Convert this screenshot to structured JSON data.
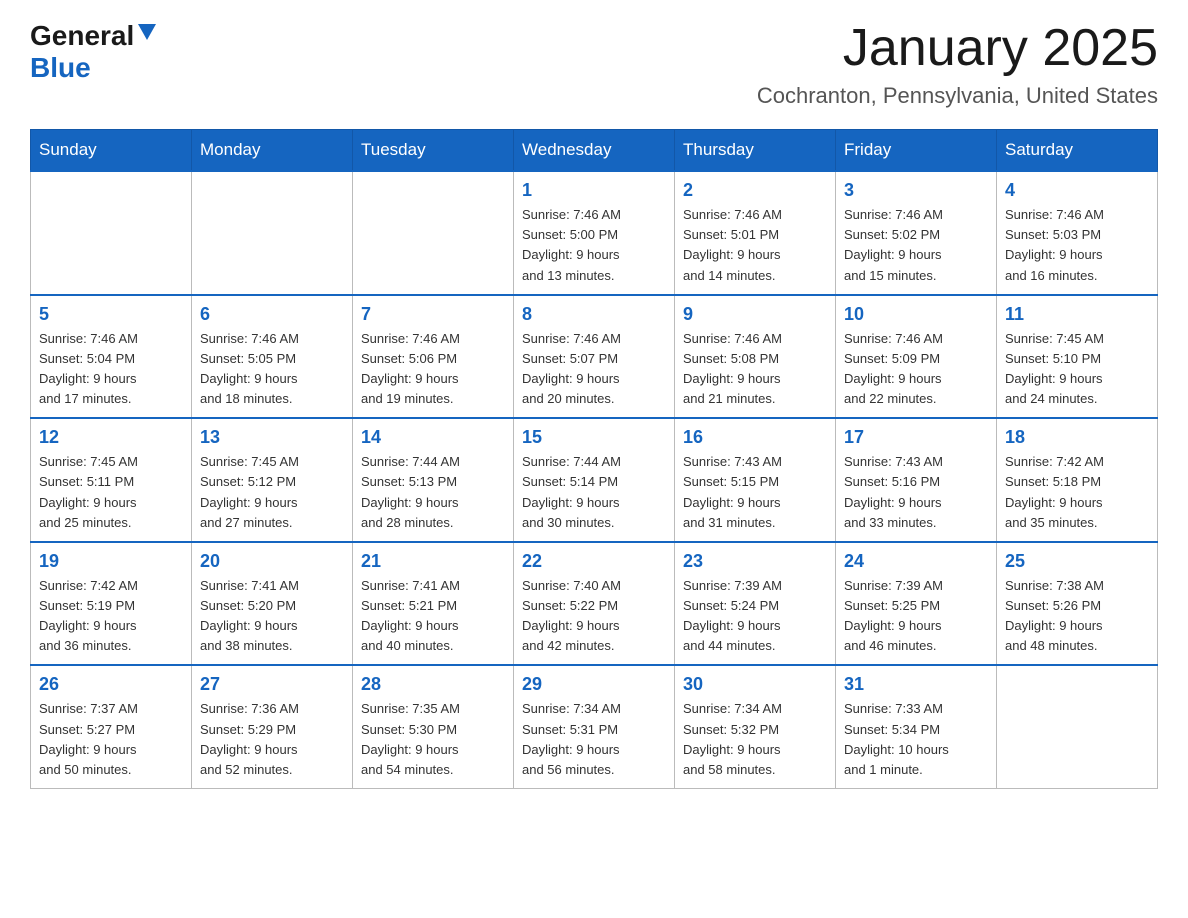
{
  "header": {
    "logo_general": "General",
    "logo_blue": "Blue",
    "title": "January 2025",
    "subtitle": "Cochranton, Pennsylvania, United States"
  },
  "days_of_week": [
    "Sunday",
    "Monday",
    "Tuesday",
    "Wednesday",
    "Thursday",
    "Friday",
    "Saturday"
  ],
  "weeks": [
    [
      {
        "day": "",
        "info": ""
      },
      {
        "day": "",
        "info": ""
      },
      {
        "day": "",
        "info": ""
      },
      {
        "day": "1",
        "info": "Sunrise: 7:46 AM\nSunset: 5:00 PM\nDaylight: 9 hours\nand 13 minutes."
      },
      {
        "day": "2",
        "info": "Sunrise: 7:46 AM\nSunset: 5:01 PM\nDaylight: 9 hours\nand 14 minutes."
      },
      {
        "day": "3",
        "info": "Sunrise: 7:46 AM\nSunset: 5:02 PM\nDaylight: 9 hours\nand 15 minutes."
      },
      {
        "day": "4",
        "info": "Sunrise: 7:46 AM\nSunset: 5:03 PM\nDaylight: 9 hours\nand 16 minutes."
      }
    ],
    [
      {
        "day": "5",
        "info": "Sunrise: 7:46 AM\nSunset: 5:04 PM\nDaylight: 9 hours\nand 17 minutes."
      },
      {
        "day": "6",
        "info": "Sunrise: 7:46 AM\nSunset: 5:05 PM\nDaylight: 9 hours\nand 18 minutes."
      },
      {
        "day": "7",
        "info": "Sunrise: 7:46 AM\nSunset: 5:06 PM\nDaylight: 9 hours\nand 19 minutes."
      },
      {
        "day": "8",
        "info": "Sunrise: 7:46 AM\nSunset: 5:07 PM\nDaylight: 9 hours\nand 20 minutes."
      },
      {
        "day": "9",
        "info": "Sunrise: 7:46 AM\nSunset: 5:08 PM\nDaylight: 9 hours\nand 21 minutes."
      },
      {
        "day": "10",
        "info": "Sunrise: 7:46 AM\nSunset: 5:09 PM\nDaylight: 9 hours\nand 22 minutes."
      },
      {
        "day": "11",
        "info": "Sunrise: 7:45 AM\nSunset: 5:10 PM\nDaylight: 9 hours\nand 24 minutes."
      }
    ],
    [
      {
        "day": "12",
        "info": "Sunrise: 7:45 AM\nSunset: 5:11 PM\nDaylight: 9 hours\nand 25 minutes."
      },
      {
        "day": "13",
        "info": "Sunrise: 7:45 AM\nSunset: 5:12 PM\nDaylight: 9 hours\nand 27 minutes."
      },
      {
        "day": "14",
        "info": "Sunrise: 7:44 AM\nSunset: 5:13 PM\nDaylight: 9 hours\nand 28 minutes."
      },
      {
        "day": "15",
        "info": "Sunrise: 7:44 AM\nSunset: 5:14 PM\nDaylight: 9 hours\nand 30 minutes."
      },
      {
        "day": "16",
        "info": "Sunrise: 7:43 AM\nSunset: 5:15 PM\nDaylight: 9 hours\nand 31 minutes."
      },
      {
        "day": "17",
        "info": "Sunrise: 7:43 AM\nSunset: 5:16 PM\nDaylight: 9 hours\nand 33 minutes."
      },
      {
        "day": "18",
        "info": "Sunrise: 7:42 AM\nSunset: 5:18 PM\nDaylight: 9 hours\nand 35 minutes."
      }
    ],
    [
      {
        "day": "19",
        "info": "Sunrise: 7:42 AM\nSunset: 5:19 PM\nDaylight: 9 hours\nand 36 minutes."
      },
      {
        "day": "20",
        "info": "Sunrise: 7:41 AM\nSunset: 5:20 PM\nDaylight: 9 hours\nand 38 minutes."
      },
      {
        "day": "21",
        "info": "Sunrise: 7:41 AM\nSunset: 5:21 PM\nDaylight: 9 hours\nand 40 minutes."
      },
      {
        "day": "22",
        "info": "Sunrise: 7:40 AM\nSunset: 5:22 PM\nDaylight: 9 hours\nand 42 minutes."
      },
      {
        "day": "23",
        "info": "Sunrise: 7:39 AM\nSunset: 5:24 PM\nDaylight: 9 hours\nand 44 minutes."
      },
      {
        "day": "24",
        "info": "Sunrise: 7:39 AM\nSunset: 5:25 PM\nDaylight: 9 hours\nand 46 minutes."
      },
      {
        "day": "25",
        "info": "Sunrise: 7:38 AM\nSunset: 5:26 PM\nDaylight: 9 hours\nand 48 minutes."
      }
    ],
    [
      {
        "day": "26",
        "info": "Sunrise: 7:37 AM\nSunset: 5:27 PM\nDaylight: 9 hours\nand 50 minutes."
      },
      {
        "day": "27",
        "info": "Sunrise: 7:36 AM\nSunset: 5:29 PM\nDaylight: 9 hours\nand 52 minutes."
      },
      {
        "day": "28",
        "info": "Sunrise: 7:35 AM\nSunset: 5:30 PM\nDaylight: 9 hours\nand 54 minutes."
      },
      {
        "day": "29",
        "info": "Sunrise: 7:34 AM\nSunset: 5:31 PM\nDaylight: 9 hours\nand 56 minutes."
      },
      {
        "day": "30",
        "info": "Sunrise: 7:34 AM\nSunset: 5:32 PM\nDaylight: 9 hours\nand 58 minutes."
      },
      {
        "day": "31",
        "info": "Sunrise: 7:33 AM\nSunset: 5:34 PM\nDaylight: 10 hours\nand 1 minute."
      },
      {
        "day": "",
        "info": ""
      }
    ]
  ]
}
